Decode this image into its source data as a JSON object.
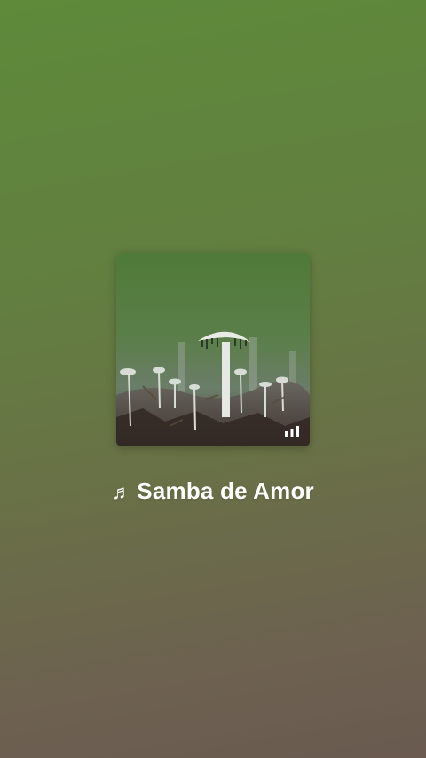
{
  "player": {
    "album_art": "mushroom-photo",
    "now_playing_icon": "equalizer-icon",
    "song_title_icon": "music-note-icon",
    "song_title": "Samba de Amor"
  },
  "colors": {
    "background_top": "#5e8a3a",
    "background_bottom": "#6a5a50",
    "text": "#ffffff"
  }
}
